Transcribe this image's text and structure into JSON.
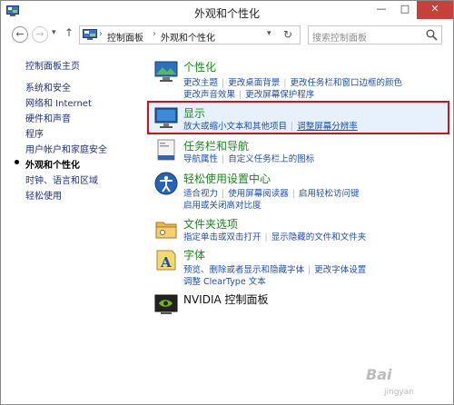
{
  "window": {
    "title": "外观和个性化"
  },
  "title_buttons": {
    "minimize": "—",
    "maximize": "□",
    "close": "✕"
  },
  "nav": {
    "back": "←",
    "forward": "→",
    "up": "↑",
    "dropdown": "▾",
    "address": [
      "控制面板",
      "外观和个性化"
    ],
    "separator": "›",
    "refresh": "↻",
    "search_placeholder": "搜索控制面板"
  },
  "sidebar": {
    "items": [
      {
        "label": "控制面板主页"
      },
      {
        "label": "系统和安全"
      },
      {
        "label": "网络和 Internet"
      },
      {
        "label": "硬件和声音"
      },
      {
        "label": "程序"
      },
      {
        "label": "用户帐户和家庭安全"
      },
      {
        "label": "外观和个性化",
        "current": true
      },
      {
        "label": "时钟、语言和区域"
      },
      {
        "label": "轻松使用"
      }
    ]
  },
  "categories": [
    {
      "title": "个性化",
      "icon": "personalization-icon",
      "link_rows": [
        [
          "更改主题",
          "更改桌面背景",
          "更改任务栏和窗口边框的颜色"
        ],
        [
          "更改声音效果",
          "更改屏幕保护程序"
        ]
      ]
    },
    {
      "title": "显示",
      "icon": "display-icon",
      "highlighted": true,
      "link_rows": [
        [
          "放大或缩小文本和其他项目",
          "调整屏幕分辨率"
        ]
      ]
    },
    {
      "title": "任务栏和导航",
      "icon": "taskbar-icon",
      "link_rows": [
        [
          "导航属性",
          "自定义任务栏上的图标"
        ]
      ]
    },
    {
      "title": "轻松使用设置中心",
      "icon": "ease-of-access-icon",
      "link_rows": [
        [
          "适合视力",
          "使用屏幕阅读器",
          "启用轻松访问键"
        ],
        [
          "启用或关闭高对比度"
        ]
      ]
    },
    {
      "title": "文件夹选项",
      "icon": "folder-options-icon",
      "link_rows": [
        [
          "指定单击或双击打开",
          "显示隐藏的文件和文件夹"
        ]
      ]
    },
    {
      "title": "字体",
      "icon": "fonts-icon",
      "link_rows": [
        [
          "预览、删除或者显示和隐藏字体",
          "更改字体设置"
        ],
        [
          "调整 ClearType 文本"
        ]
      ]
    },
    {
      "title": "NVIDIA 控制面板",
      "icon": "nvidia-icon",
      "link_rows": []
    }
  ],
  "watermark": {
    "text": "Bai",
    "sub": "jingyan"
  }
}
